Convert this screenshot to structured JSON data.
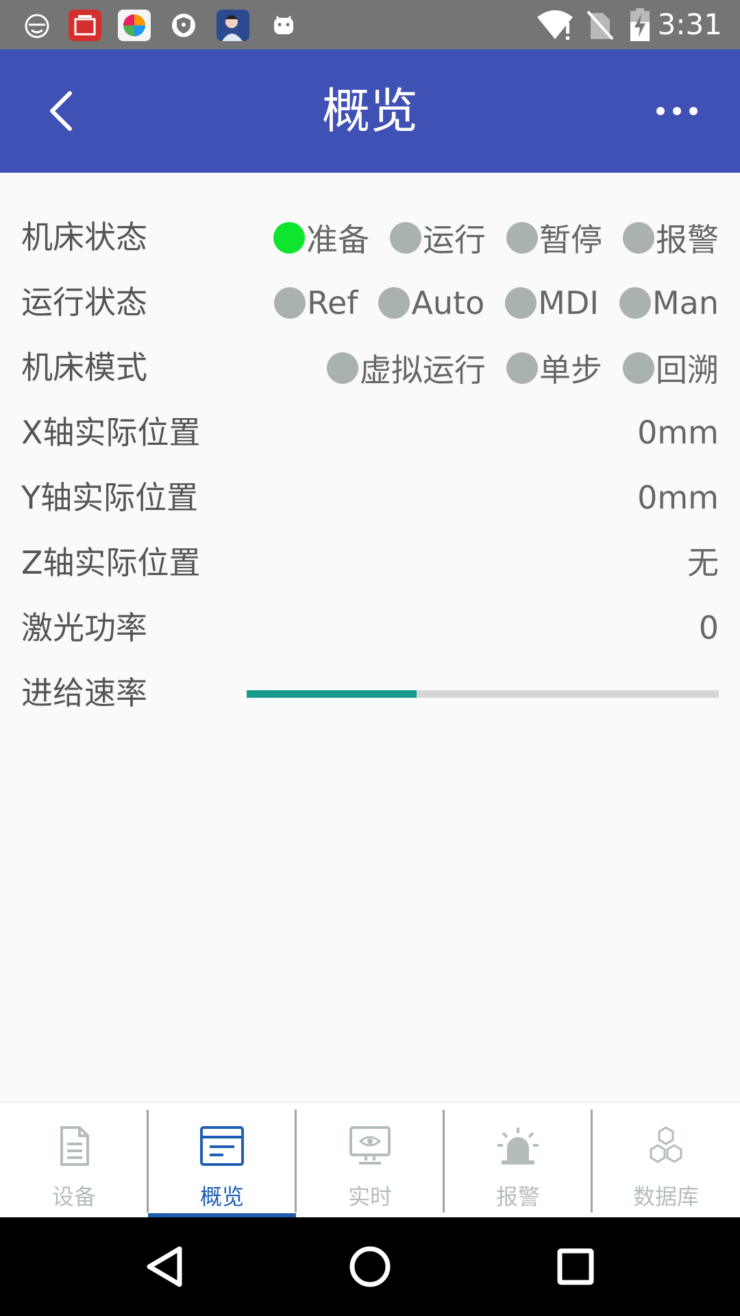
{
  "status_bar": {
    "time": "3:31",
    "icons": [
      "app-icon-1",
      "app-icon-news",
      "app-icon-colorful",
      "app-icon-shield",
      "app-icon-avatar",
      "android-icon",
      "wifi-icon",
      "no-sim-icon",
      "battery-charging-icon"
    ]
  },
  "app_bar": {
    "title": "概览",
    "back_icon": "chevron-left-icon",
    "more_icon": "more-horizontal-icon"
  },
  "rows": {
    "machine_status": {
      "label": "机床状态",
      "options": [
        {
          "label": "准备",
          "active": true
        },
        {
          "label": "运行",
          "active": false
        },
        {
          "label": "暂停",
          "active": false
        },
        {
          "label": "报警",
          "active": false
        }
      ]
    },
    "run_status": {
      "label": "运行状态",
      "options": [
        {
          "label": "Ref",
          "active": false
        },
        {
          "label": "Auto",
          "active": false
        },
        {
          "label": "MDI",
          "active": false
        },
        {
          "label": "Man",
          "active": false
        }
      ]
    },
    "machine_mode": {
      "label": "机床模式",
      "options": [
        {
          "label": "虚拟运行",
          "active": false
        },
        {
          "label": "单步",
          "active": false
        },
        {
          "label": "回溯",
          "active": false
        }
      ]
    },
    "x_pos": {
      "label": "X轴实际位置",
      "value": "0mm"
    },
    "y_pos": {
      "label": "Y轴实际位置",
      "value": "0mm"
    },
    "z_pos": {
      "label": "Z轴实际位置",
      "value": "无"
    },
    "laser_power": {
      "label": "激光功率",
      "value": "0"
    },
    "feed_rate": {
      "label": "进给速率",
      "progress_fraction": 0.36
    }
  },
  "colors": {
    "app_bar": "#3f51b5",
    "active_dot": "#0de52e",
    "inactive_dot": "#a9b2b1",
    "progress_fill": "#159a8b",
    "active_tab": "#1e5fb3"
  },
  "tabs": [
    {
      "label": "设备",
      "icon": "document-icon",
      "active": false
    },
    {
      "label": "概览",
      "icon": "overview-icon",
      "active": true
    },
    {
      "label": "实时",
      "icon": "monitor-eye-icon",
      "active": false
    },
    {
      "label": "报警",
      "icon": "alarm-siren-icon",
      "active": false
    },
    {
      "label": "数据库",
      "icon": "database-hex-icon",
      "active": false
    }
  ],
  "nav": {
    "icons": [
      "back-triangle-icon",
      "home-circle-icon",
      "recents-square-icon"
    ]
  }
}
